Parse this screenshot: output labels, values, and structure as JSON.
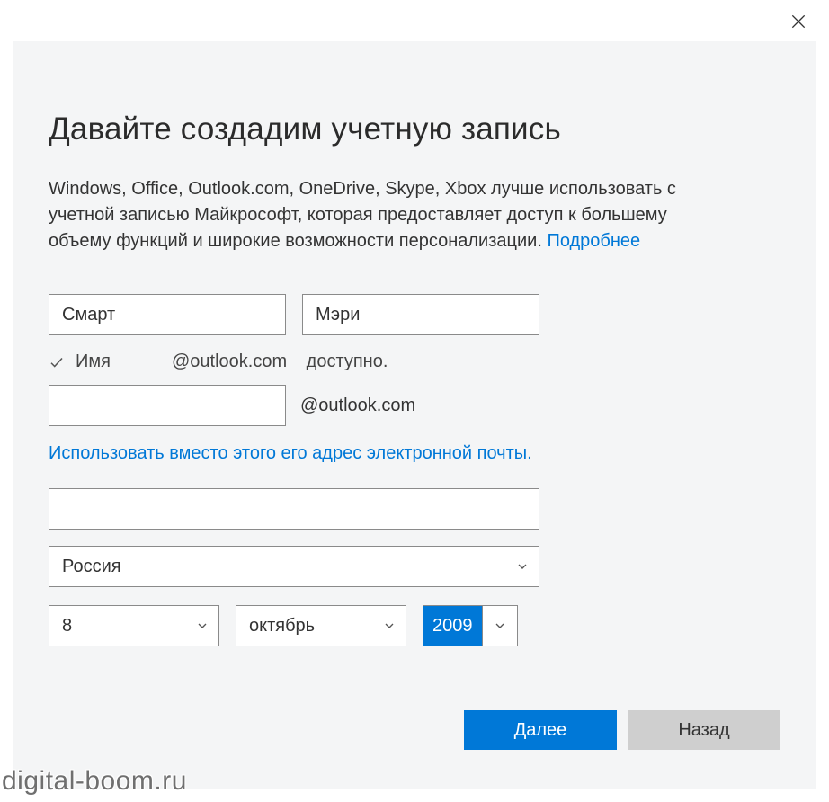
{
  "window": {
    "close_icon": "close"
  },
  "heading": "Давайте создадим учетную запись",
  "description": {
    "text": "Windows, Office, Outlook.com, OneDrive, Skype, Xbox лучше использовать с учетной записью Майкрософт, которая предоставляет доступ к большему объему функций и широкие возможности персонализации. ",
    "more_link": "Подробнее"
  },
  "form": {
    "first_name": "Смарт",
    "last_name": "Мэри",
    "availability": {
      "name_label": "Имя",
      "domain_text": "@outlook.com",
      "status_text": "доступно."
    },
    "email_local": "",
    "email_suffix": "@outlook.com",
    "use_existing_email_link": "Использовать вместо этого его адрес электронной почты.",
    "password": "",
    "country": "Россия",
    "dob": {
      "day": "8",
      "month": "октябрь",
      "year": "2009"
    }
  },
  "buttons": {
    "next": "Далее",
    "back": "Назад"
  },
  "watermark": "digital-boom.ru"
}
